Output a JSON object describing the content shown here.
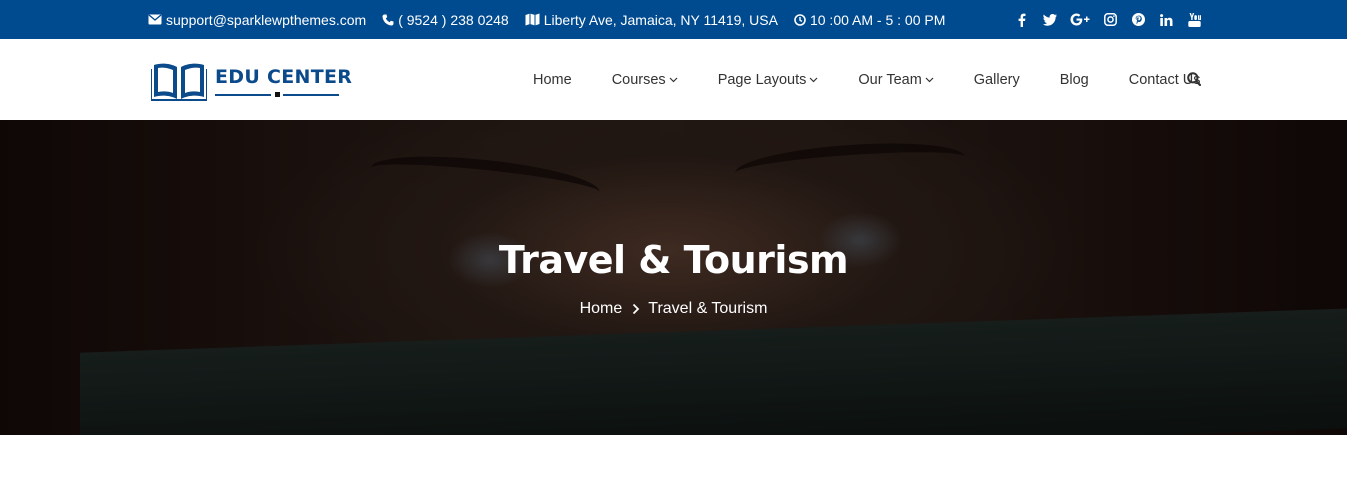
{
  "topbar": {
    "email": "support@sparklewpthemes.com",
    "phone": "( 9524 ) 238 0248",
    "address": "Liberty Ave, Jamaica, NY 11419, USA",
    "hours": "10 :00 AM - 5 : 00 PM",
    "social": [
      "facebook-icon",
      "twitter-icon",
      "google-plus-icon",
      "instagram-icon",
      "pinterest-icon",
      "linkedin-icon",
      "youtube-icon"
    ]
  },
  "logo": {
    "text": "EDU CENTER"
  },
  "nav": {
    "items": [
      {
        "label": "Home",
        "has_dropdown": false
      },
      {
        "label": "Courses",
        "has_dropdown": true
      },
      {
        "label": "Page Layouts",
        "has_dropdown": true
      },
      {
        "label": "Our Team",
        "has_dropdown": true
      },
      {
        "label": "Gallery",
        "has_dropdown": false
      },
      {
        "label": "Blog",
        "has_dropdown": false
      },
      {
        "label": "Contact Us",
        "has_dropdown": false
      }
    ]
  },
  "hero": {
    "title": "Travel & Tourism",
    "breadcrumb": {
      "home": "Home",
      "current": "Travel & Tourism"
    }
  },
  "colors": {
    "primary": "#004a8f",
    "logo": "#0b4a8b",
    "text": "#333333"
  }
}
